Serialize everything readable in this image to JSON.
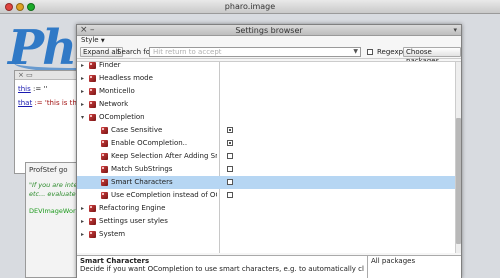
{
  "app_window": {
    "title": "pharo.image"
  },
  "background": {
    "logo_text": "Pharo",
    "workspace": {
      "line1_var": "this",
      "line1_rest": " := ''",
      "line2_var": "that",
      "line2_rest": " := 'this is the tim"
    },
    "profstef": {
      "title": "ProfStef go",
      "line1": "\"If you are interes",
      "line2": "etc... evaluate\"",
      "link": "DEVImageWorks"
    }
  },
  "settings_browser": {
    "title": "Settings browser",
    "style_label": "Style",
    "toolbar": {
      "expand_all": "Expand all",
      "search_for_label": "Search for:",
      "search_placeholder": "Hit return to accept",
      "regexp_label": "Regexp",
      "regexp_checked": false,
      "choose_packages": "Choose packages"
    },
    "rows": [
      {
        "label": "Finder",
        "level": 0,
        "expander": "▸",
        "icon": "package-icon",
        "value": null,
        "selected": false
      },
      {
        "label": "Headless mode",
        "level": 0,
        "expander": "▸",
        "icon": "package-icon",
        "value": null,
        "selected": false
      },
      {
        "label": "Monticello",
        "level": 0,
        "expander": "▸",
        "icon": "package-icon",
        "value": null,
        "selected": false
      },
      {
        "label": "Network",
        "level": 0,
        "expander": "▸",
        "icon": "package-icon",
        "value": null,
        "selected": false
      },
      {
        "label": "OCompletion",
        "level": 0,
        "expander": "▾",
        "icon": "package-icon",
        "value": null,
        "selected": false
      },
      {
        "label": "Case Sensitive",
        "level": 1,
        "expander": "",
        "icon": "setting-icon",
        "value": true,
        "selected": false
      },
      {
        "label": "Enable OCompletion..",
        "level": 1,
        "expander": "",
        "icon": "setting-icon",
        "value": true,
        "selected": false
      },
      {
        "label": "Keep Selection After Adding Smart Char",
        "level": 1,
        "expander": "",
        "icon": "setting-icon",
        "value": false,
        "selected": false
      },
      {
        "label": "Match SubStrings",
        "level": 1,
        "expander": "",
        "icon": "setting-icon",
        "value": false,
        "selected": false
      },
      {
        "label": "Smart Characters",
        "level": 1,
        "expander": "",
        "icon": "setting-icon",
        "value": false,
        "selected": true
      },
      {
        "label": "Use eCompletion instead of OCompletio",
        "level": 1,
        "expander": "",
        "icon": "setting-icon",
        "value": false,
        "selected": false
      },
      {
        "label": "Refactoring Engine",
        "level": 0,
        "expander": "▸",
        "icon": "package-icon",
        "value": null,
        "selected": false
      },
      {
        "label": "Settings user styles",
        "level": 0,
        "expander": "▸",
        "icon": "package-icon",
        "value": null,
        "selected": false
      },
      {
        "label": "System",
        "level": 0,
        "expander": "▸",
        "icon": "package-icon",
        "value": null,
        "selected": false
      }
    ],
    "description": {
      "title": "Smart Characters",
      "text": "Decide if you want OCompletion to use smart characters, e.g. to automatically close brackets."
    },
    "packages_panel": {
      "label": "All packages"
    }
  }
}
